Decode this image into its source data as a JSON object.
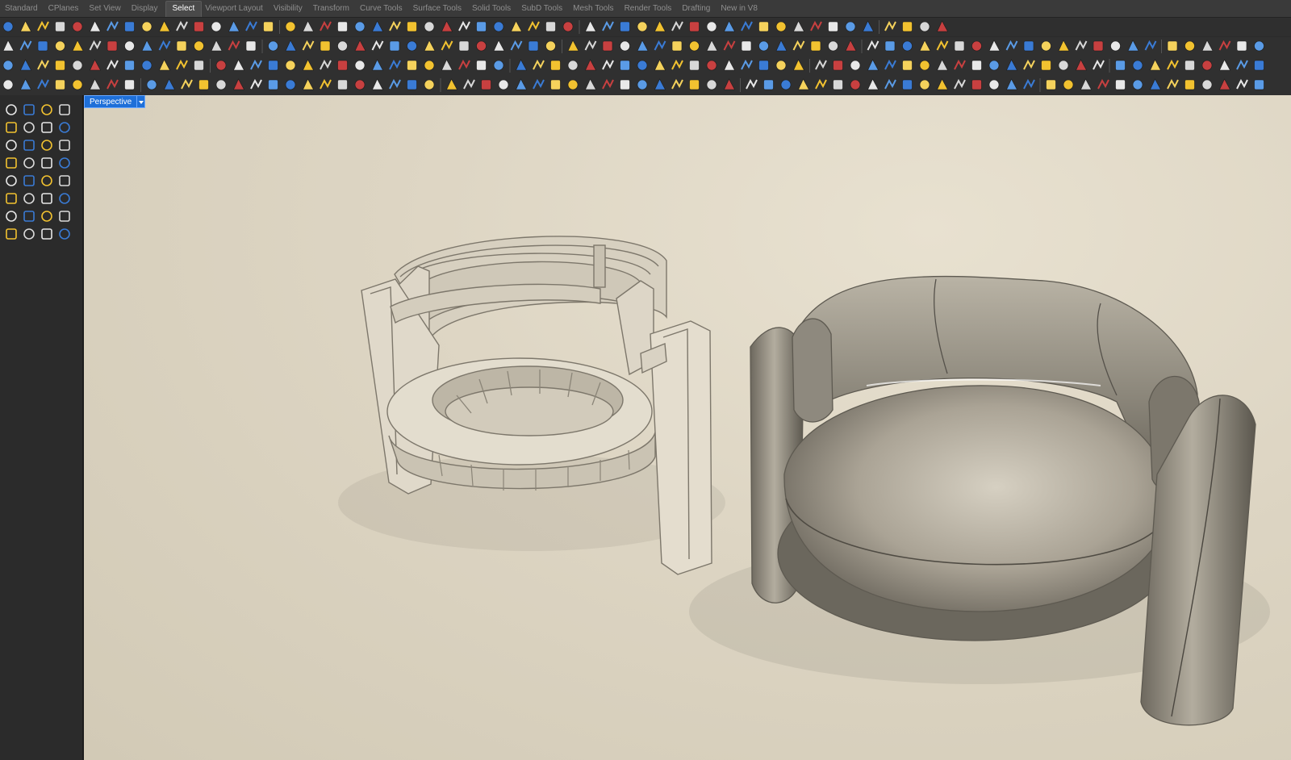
{
  "app": {
    "tabs": [
      {
        "label": "Standard",
        "active": false
      },
      {
        "label": "CPlanes",
        "active": false
      },
      {
        "label": "Set View",
        "active": false
      },
      {
        "label": "Display",
        "active": false
      },
      {
        "label": "Select",
        "active": true
      },
      {
        "label": "Viewport Layout",
        "active": false
      },
      {
        "label": "Visibility",
        "active": false
      },
      {
        "label": "Transform",
        "active": false
      },
      {
        "label": "Curve Tools",
        "active": false
      },
      {
        "label": "Surface Tools",
        "active": false
      },
      {
        "label": "Solid Tools",
        "active": false
      },
      {
        "label": "SubD Tools",
        "active": false
      },
      {
        "label": "Mesh Tools",
        "active": false
      },
      {
        "label": "Render Tools",
        "active": false
      },
      {
        "label": "Drafting",
        "active": false
      },
      {
        "label": "New in V8",
        "active": false
      }
    ]
  },
  "toolbars": {
    "select_row": {
      "icon_count": 54
    },
    "main_row_1": {
      "icon_count": 72
    },
    "main_row_2": {
      "icon_count": 72
    },
    "main_row_3": {
      "icon_count": 72
    }
  },
  "sidebar": {
    "tool_rows": 8,
    "tools_per_row": 4
  },
  "viewport": {
    "title": "Perspective",
    "objects": [
      "chair-frame-model",
      "upholstered-chair-model"
    ]
  },
  "colors": {
    "accent": "#1e6fd8",
    "ui_dark": "#2b2b2b",
    "icon_yellow": "#f2c230",
    "icon_blue": "#3a7bd5",
    "viewport_paper": "#ddd5c3"
  }
}
